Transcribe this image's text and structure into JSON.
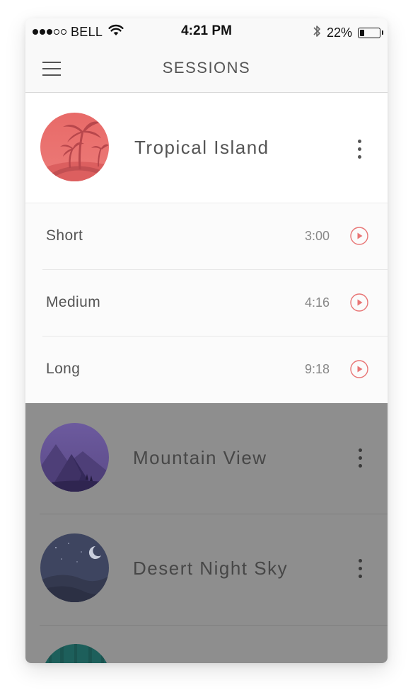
{
  "status_bar": {
    "carrier": "BELL",
    "time": "4:21 PM",
    "battery_percent_label": "22%",
    "battery_level": 0.22,
    "signal_strength": 3,
    "signal_max": 5,
    "icons": [
      "wifi-icon",
      "bluetooth-icon",
      "battery-icon"
    ]
  },
  "navbar": {
    "title": "SESSIONS",
    "menu_icon": "hamburger-menu-icon"
  },
  "expanded_session": {
    "title": "Tropical Island",
    "image": "tropical-island-thumbnail",
    "accent_color": "#e07070",
    "options": [
      {
        "label": "Short",
        "duration": "3:00"
      },
      {
        "label": "Medium",
        "duration": "4:16"
      },
      {
        "label": "Long",
        "duration": "9:18"
      }
    ]
  },
  "other_sessions": [
    {
      "title": "Mountain View",
      "image": "mountain-view-thumbnail"
    },
    {
      "title": "Desert Night Sky",
      "image": "desert-night-sky-thumbnail"
    },
    {
      "title": "",
      "image": "forest-thumbnail"
    }
  ],
  "colors": {
    "accent": "#e87575",
    "overlay": "#8e8e8e",
    "text": "#555555"
  }
}
